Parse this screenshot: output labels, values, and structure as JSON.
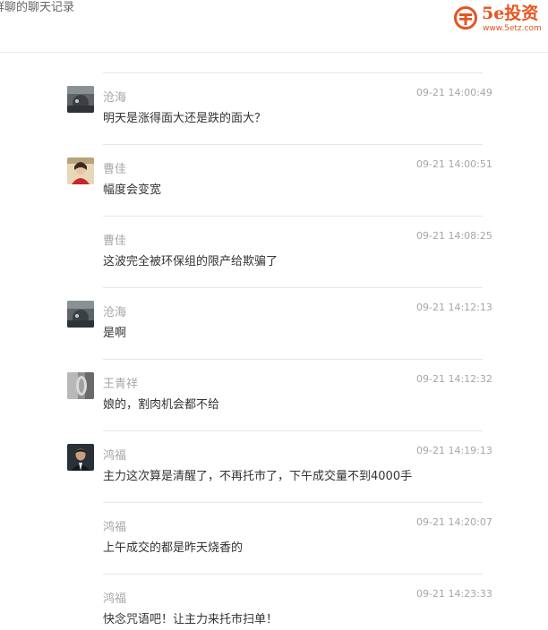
{
  "header": {
    "title": "群聊的聊天记录",
    "logo": {
      "name": "5e投资",
      "url": "www.5etz.com",
      "color": "#e8531f"
    }
  },
  "messages": [
    {
      "name": "沧海",
      "time": "09-21 14:00:49",
      "text": "明天是涨得面大还是跌的面大？",
      "has_avatar": true,
      "avatar_icon": "sea-photo-avatar"
    },
    {
      "name": "曹佳",
      "time": "09-21 14:00:51",
      "text": "幅度会变宽",
      "has_avatar": true,
      "avatar_icon": "woman-photo-avatar"
    },
    {
      "name": "曹佳",
      "time": "09-21 14:08:25",
      "text": "这波完全被环保组的限产给欺骗了",
      "has_avatar": false
    },
    {
      "name": "沧海",
      "time": "09-21 14:12:13",
      "text": "是啊",
      "has_avatar": true,
      "avatar_icon": "sea-photo-avatar"
    },
    {
      "name": "王青祥",
      "time": "09-21 14:12:32",
      "text": "娘的，割肉机会都不给",
      "has_avatar": true,
      "avatar_icon": "gray-photo-avatar"
    },
    {
      "name": "鸿福",
      "time": "09-21 14:19:13",
      "text": "主力这次算是清醒了，不再托市了，下午成交量不到4000手",
      "has_avatar": true,
      "avatar_icon": "man-photo-avatar"
    },
    {
      "name": "鸿福",
      "time": "09-21 14:20:07",
      "text": "上午成交的都是昨天烧香的",
      "has_avatar": false
    },
    {
      "name": "鸿福",
      "time": "09-21 14:23:33",
      "text": "快念咒语吧！让主力来托市扫单！",
      "has_avatar": false
    }
  ]
}
